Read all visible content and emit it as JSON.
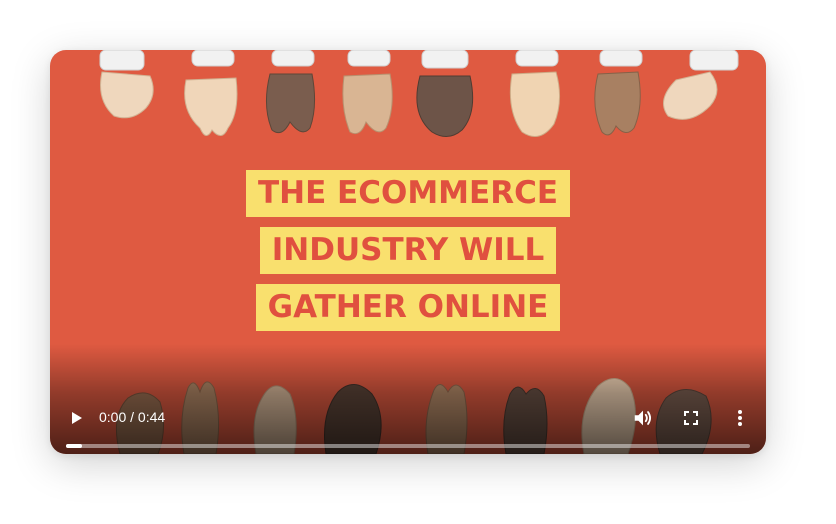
{
  "video": {
    "headline_lines": [
      "THE ECOMMERCE",
      "INDUSTRY WILL",
      "GATHER ONLINE"
    ],
    "background_color": "#df5a41",
    "highlight_color": "#f9e06e",
    "text_color": "#e0503f"
  },
  "player": {
    "time_display": "0:00 / 0:44",
    "progress_fraction": 0,
    "icons": {
      "play": "play-icon",
      "volume": "volume-icon",
      "fullscreen": "fullscreen-icon",
      "more": "more-vertical-icon"
    }
  }
}
